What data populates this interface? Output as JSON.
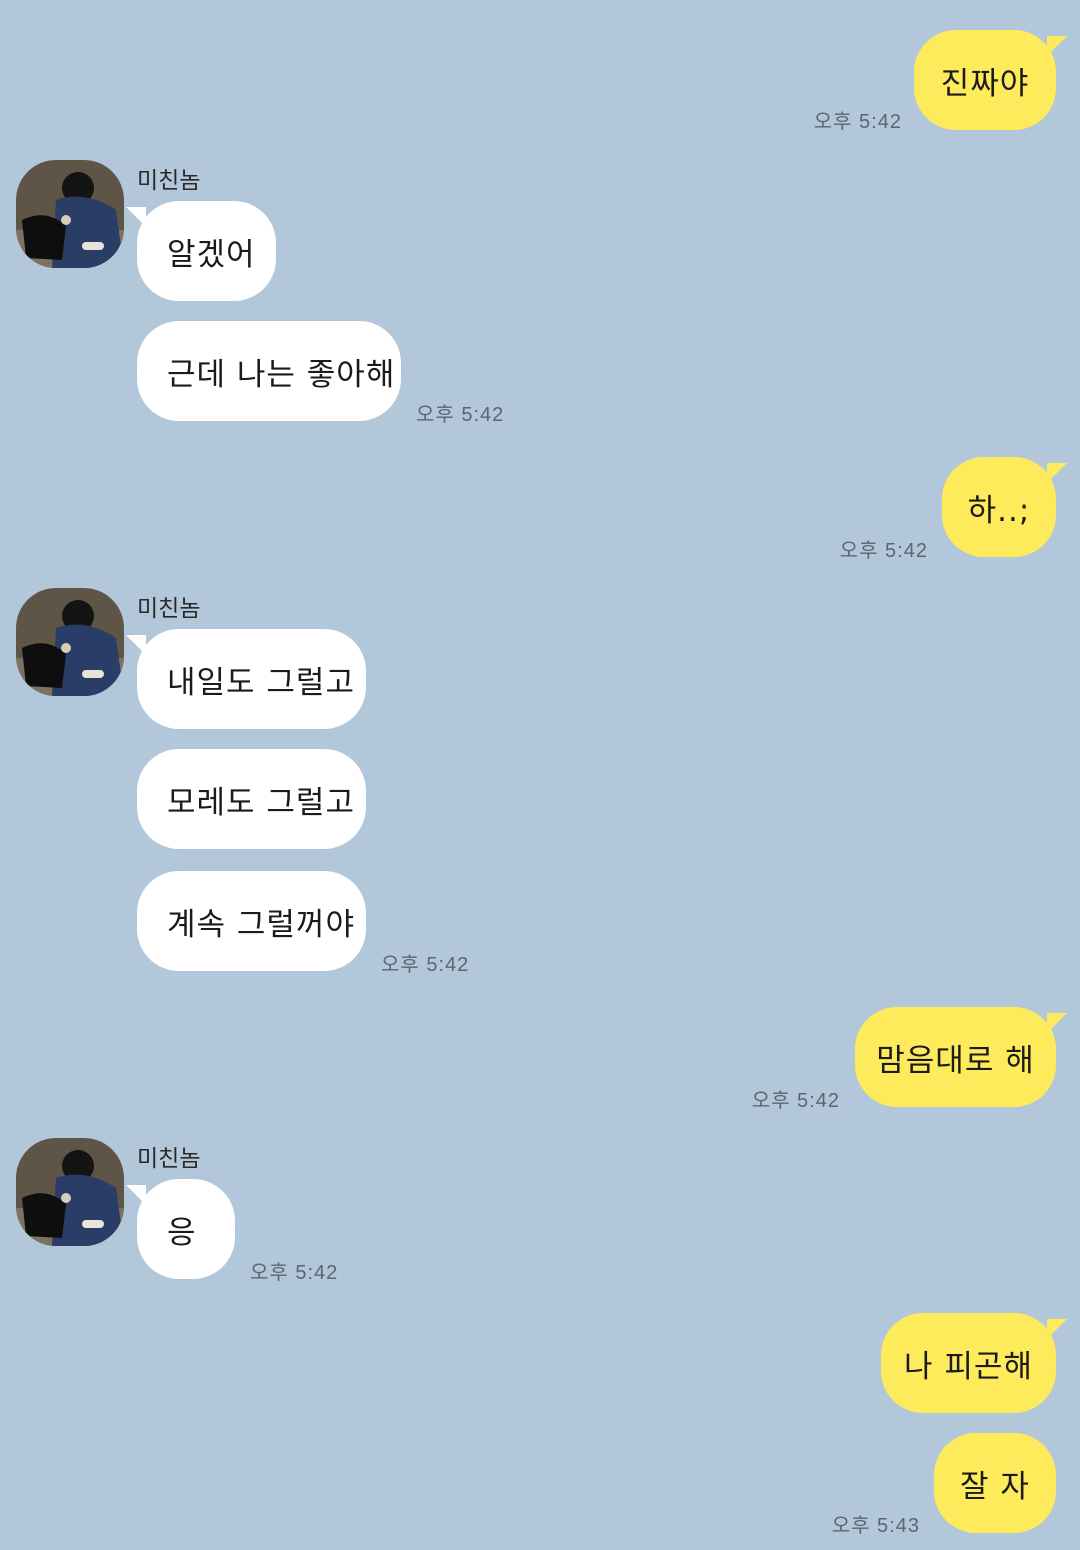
{
  "chat": {
    "contact_name": "미친놈",
    "messages": [
      {
        "sender": "me",
        "text": "진짜야",
        "time": "오후 5:42"
      },
      {
        "sender": "contact",
        "text": "알겠어"
      },
      {
        "sender": "contact",
        "text": "근데 나는 좋아해",
        "time": "오후 5:42"
      },
      {
        "sender": "me",
        "text": "하..;",
        "time": "오후 5:42"
      },
      {
        "sender": "contact",
        "text": "내일도 그럴고"
      },
      {
        "sender": "contact",
        "text": "모레도 그럴고"
      },
      {
        "sender": "contact",
        "text": "계속 그럴꺼야",
        "time": "오후 5:42"
      },
      {
        "sender": "me",
        "text": "맘음대로 해",
        "time": "오후 5:42"
      },
      {
        "sender": "contact",
        "text": "응",
        "time": "오후 5:42"
      },
      {
        "sender": "me",
        "text": "나 피곤해"
      },
      {
        "sender": "me",
        "text": "잘 자",
        "time": "오후 5:43"
      }
    ]
  },
  "colors": {
    "background": "#b2c7da",
    "my_bubble": "#feeb5c",
    "their_bubble": "#ffffff",
    "timestamp": "#5b6670"
  },
  "icons": {
    "avatar": "profile-photo-icon"
  }
}
